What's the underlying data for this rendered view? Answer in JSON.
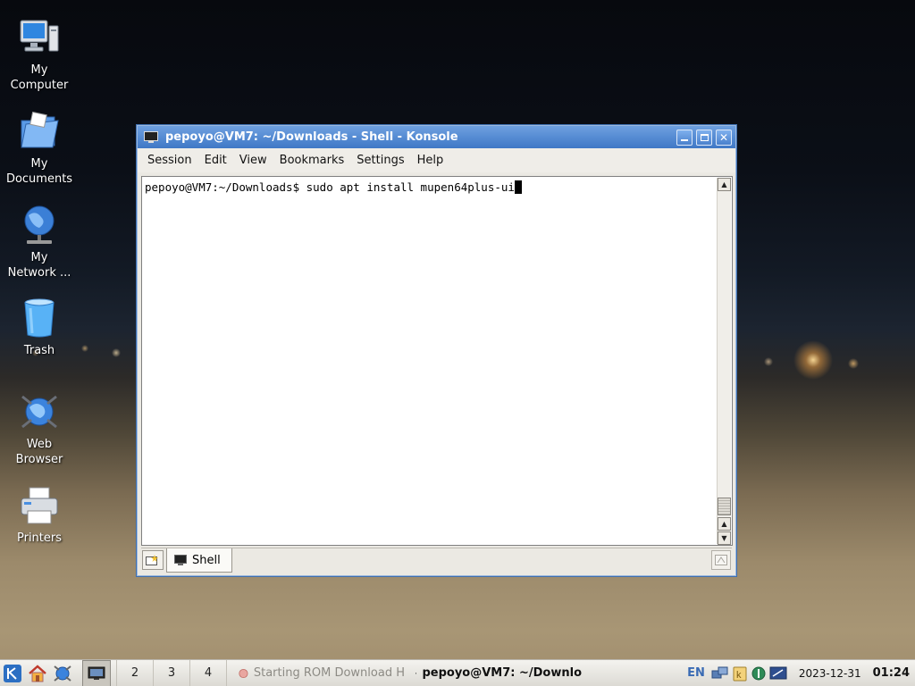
{
  "desktop": {
    "icons": [
      {
        "label": "My\nComputer",
        "icon": "computer-icon"
      },
      {
        "label": "My\nDocuments",
        "icon": "folder-icon"
      },
      {
        "label": "My\nNetwork ...",
        "icon": "network-globe-icon"
      },
      {
        "label": "Trash",
        "icon": "trash-icon"
      },
      {
        "label": "Web\nBrowser",
        "icon": "web-browser-icon"
      },
      {
        "label": "Printers",
        "icon": "printer-icon"
      }
    ]
  },
  "window": {
    "title": "pepoyo@VM7: ~/Downloads - Shell - Konsole",
    "menu": [
      "Session",
      "Edit",
      "View",
      "Bookmarks",
      "Settings",
      "Help"
    ],
    "terminal": {
      "prompt": "pepoyo@VM7:~/Downloads$ ",
      "command": "sudo apt install mupen64plus-ui"
    },
    "tab_label": "Shell"
  },
  "taskbar": {
    "desktops": [
      "2",
      "3",
      "4"
    ],
    "tasks": [
      {
        "label": "Starting ROM Download H",
        "state": "inactive"
      },
      {
        "label": "pepoyo@VM7: ~/Downlo",
        "state": "active"
      }
    ],
    "language": "EN",
    "date": "2023-12-31",
    "time": "01:24"
  },
  "colors": {
    "titlebar": "#3f78c6",
    "window_bg": "#ebe9e3",
    "terminal_bg": "#ffffff",
    "language_indicator": "#3a6bb4"
  }
}
